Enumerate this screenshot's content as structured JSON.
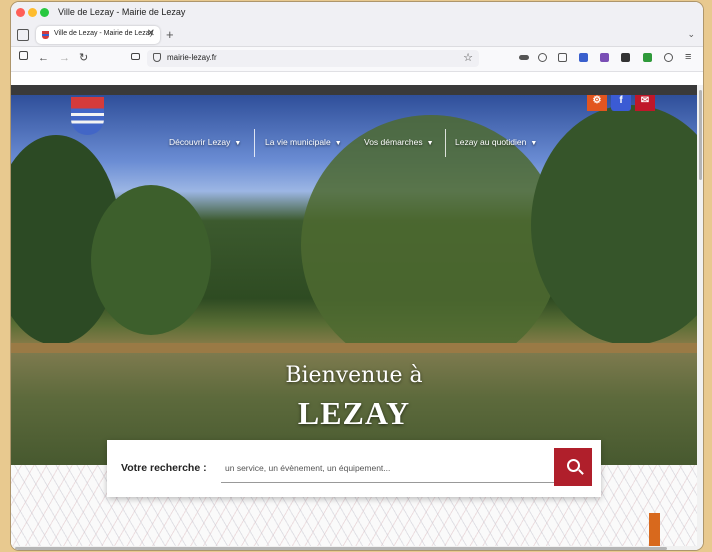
{
  "window": {
    "title": "Ville de Lezay - Mairie de Lezay"
  },
  "tabs": [
    {
      "label": "Ville de Lezay - Mairie de Lezay",
      "close": "✕"
    }
  ],
  "tabstrip": {
    "new_tab": "+",
    "list": "⌄"
  },
  "navbar": {
    "back": "←",
    "forward": "→",
    "reload": "↻",
    "url": "mairie-lezay.fr",
    "bookmark": "☆",
    "menu": "≡"
  },
  "site": {
    "menu": [
      {
        "label": "Découvrir Lezay"
      },
      {
        "label": "La vie municipale"
      },
      {
        "label": "Vos démarches"
      },
      {
        "label": "Lezay au quotidien"
      }
    ],
    "caret": "▼",
    "social": [
      {
        "name": "intramuros",
        "glyph": "⚙",
        "color": "#e2551f"
      },
      {
        "name": "facebook",
        "glyph": "f",
        "color": "#3b5bd4"
      },
      {
        "name": "email",
        "glyph": "✉",
        "color": "#c0172a"
      }
    ],
    "welcome": "Bienvenue à",
    "town": "LEZAY",
    "search": {
      "label": "Votre recherche :",
      "placeholder": "un service, un évènement, un équipement..."
    },
    "colors": {
      "accent": "#b01f2b",
      "orange": "#d8691d"
    }
  }
}
